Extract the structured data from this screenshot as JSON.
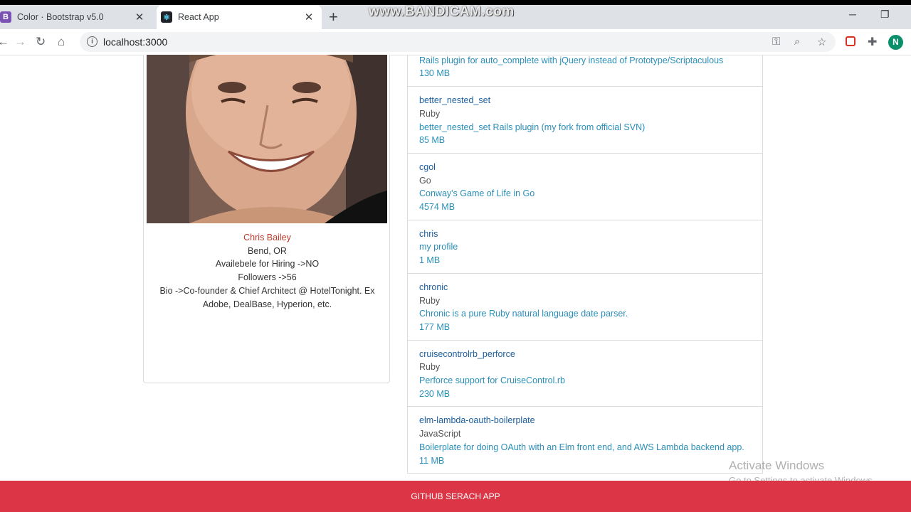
{
  "browser": {
    "tabs": [
      {
        "title": "Color · Bootstrap v5.0",
        "favicon": "B"
      },
      {
        "title": "React App",
        "favicon": "⚛"
      }
    ],
    "new_tab_label": "+",
    "url": "localhost:3000",
    "profile_initial": "N",
    "watermark": "www.BANDICAM.com"
  },
  "profile": {
    "name": "Chris Bailey",
    "location": "Bend, OR",
    "hiring": "Availebele for Hiring ->NO",
    "followers": "Followers ->56",
    "bio": "Bio ->Co-founder & Chief Architect @ HotelTonight. Ex Adobe, DealBase, Hyperion, etc."
  },
  "repos": [
    {
      "name": "",
      "language": "",
      "description": "Rails plugin for auto_complete with jQuery instead of Prototype/Scriptaculous",
      "size": "130 MB"
    },
    {
      "name": "better_nested_set",
      "language": "Ruby",
      "description": "better_nested_set Rails plugin (my fork from official SVN)",
      "size": "85 MB"
    },
    {
      "name": "cgol",
      "language": "Go",
      "description": "Conway's Game of Life in Go",
      "size": "4574 MB"
    },
    {
      "name": "chris",
      "language": "",
      "description": "my profile",
      "size": "1 MB"
    },
    {
      "name": "chronic",
      "language": "Ruby",
      "description": "Chronic is a pure Ruby natural language date parser.",
      "size": "177 MB"
    },
    {
      "name": "cruisecontrolrb_perforce",
      "language": "Ruby",
      "description": "Perforce support for CruiseControl.rb",
      "size": "230 MB"
    },
    {
      "name": "elm-lambda-oauth-boilerplate",
      "language": "JavaScript",
      "description": "Boilerplate for doing OAuth with an Elm front end, and AWS Lambda backend app.",
      "size": "11 MB"
    }
  ],
  "windows": {
    "activate_title": "Activate Windows",
    "activate_sub": "Go to Settings to activate Windows."
  },
  "footer": {
    "label": "GITHUB SERACH APP"
  }
}
